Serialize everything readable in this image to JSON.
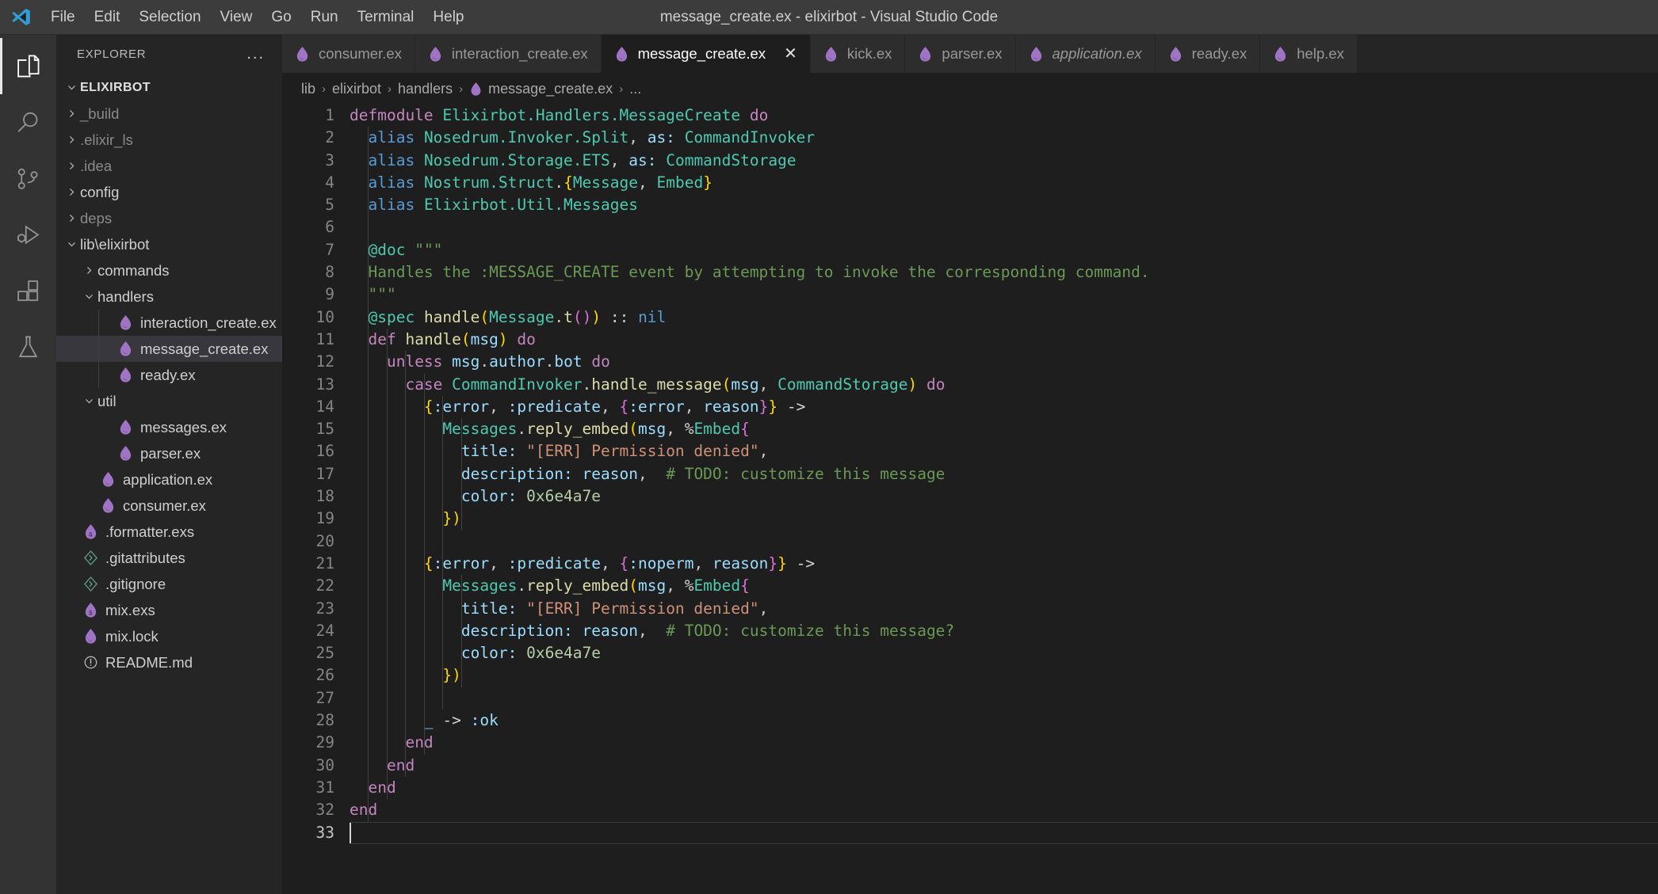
{
  "window": {
    "title": "message_create.ex - elixirbot - Visual Studio Code",
    "logo_icon": "vscode-logo-icon"
  },
  "menubar": {
    "items": [
      {
        "label": "File"
      },
      {
        "label": "Edit"
      },
      {
        "label": "Selection"
      },
      {
        "label": "View"
      },
      {
        "label": "Go"
      },
      {
        "label": "Run"
      },
      {
        "label": "Terminal"
      },
      {
        "label": "Help"
      }
    ]
  },
  "activity_bar": {
    "items": [
      {
        "name": "explorer-icon",
        "label": "Explorer",
        "active": true
      },
      {
        "name": "search-icon",
        "label": "Search",
        "active": false
      },
      {
        "name": "source-control-icon",
        "label": "Source Control",
        "active": false
      },
      {
        "name": "run-and-debug-icon",
        "label": "Run and Debug",
        "active": false
      },
      {
        "name": "extensions-icon",
        "label": "Extensions",
        "active": false
      },
      {
        "name": "testing-flask-icon",
        "label": "Testing",
        "active": false
      }
    ]
  },
  "sidebar": {
    "header_title": "EXPLORER",
    "more_actions": "...",
    "root": {
      "label": "ELIXIRBOT",
      "expanded": true
    },
    "tree": [
      {
        "label": "_build",
        "kind": "folder",
        "depth": 1,
        "expanded": false,
        "dim": true
      },
      {
        "label": ".elixir_ls",
        "kind": "folder",
        "depth": 1,
        "expanded": false,
        "dim": true
      },
      {
        "label": ".idea",
        "kind": "folder",
        "depth": 1,
        "expanded": false,
        "dim": true
      },
      {
        "label": "config",
        "kind": "folder",
        "depth": 1,
        "expanded": false,
        "dim": false
      },
      {
        "label": "deps",
        "kind": "folder",
        "depth": 1,
        "expanded": false,
        "dim": true
      },
      {
        "label": "lib\\elixirbot",
        "kind": "folder",
        "depth": 1,
        "expanded": true,
        "dim": false
      },
      {
        "label": "commands",
        "kind": "folder",
        "depth": 2,
        "expanded": false,
        "dim": false
      },
      {
        "label": "handlers",
        "kind": "folder",
        "depth": 2,
        "expanded": true,
        "dim": false
      },
      {
        "label": "interaction_create.ex",
        "kind": "file-ex",
        "depth": 3,
        "dim": false
      },
      {
        "label": "message_create.ex",
        "kind": "file-ex",
        "depth": 3,
        "dim": false,
        "selected": true
      },
      {
        "label": "ready.ex",
        "kind": "file-ex",
        "depth": 3,
        "dim": false
      },
      {
        "label": "util",
        "kind": "folder",
        "depth": 2,
        "expanded": true,
        "dim": false
      },
      {
        "label": "messages.ex",
        "kind": "file-ex",
        "depth": 3,
        "dim": false
      },
      {
        "label": "parser.ex",
        "kind": "file-ex",
        "depth": 3,
        "dim": false
      },
      {
        "label": "application.ex",
        "kind": "file-ex",
        "depth": 2,
        "dim": false
      },
      {
        "label": "consumer.ex",
        "kind": "file-ex",
        "depth": 2,
        "dim": false
      },
      {
        "label": ".formatter.exs",
        "kind": "file-exs",
        "depth": 1,
        "dim": false
      },
      {
        "label": ".gitattributes",
        "kind": "file-git",
        "depth": 1,
        "dim": false
      },
      {
        "label": ".gitignore",
        "kind": "file-git",
        "depth": 1,
        "dim": false
      },
      {
        "label": "mix.exs",
        "kind": "file-exs",
        "depth": 1,
        "dim": false
      },
      {
        "label": "mix.lock",
        "kind": "file-ex",
        "depth": 1,
        "dim": false
      },
      {
        "label": "README.md",
        "kind": "file-md",
        "depth": 1,
        "dim": false
      }
    ]
  },
  "tabs": [
    {
      "label": "consumer.ex",
      "active": false,
      "preview": false,
      "closable": false
    },
    {
      "label": "interaction_create.ex",
      "active": false,
      "preview": false,
      "closable": false
    },
    {
      "label": "message_create.ex",
      "active": true,
      "preview": false,
      "closable": true,
      "close_label": "✕"
    },
    {
      "label": "kick.ex",
      "active": false,
      "preview": false,
      "closable": false
    },
    {
      "label": "parser.ex",
      "active": false,
      "preview": false,
      "closable": false
    },
    {
      "label": "application.ex",
      "active": false,
      "preview": true,
      "closable": false
    },
    {
      "label": "ready.ex",
      "active": false,
      "preview": false,
      "closable": false
    },
    {
      "label": "help.ex",
      "active": false,
      "preview": false,
      "closable": false
    }
  ],
  "breadcrumbs": {
    "items": [
      {
        "label": "lib",
        "icon": null
      },
      {
        "label": "elixirbot",
        "icon": null
      },
      {
        "label": "handlers",
        "icon": null
      },
      {
        "label": "message_create.ex",
        "icon": "elixir-file-icon"
      },
      {
        "label": "...",
        "icon": null
      }
    ],
    "separator": "›"
  },
  "editor": {
    "language": "elixir",
    "cursor_line": 33,
    "line_count": 33,
    "line_numbers": [
      "1",
      "2",
      "3",
      "4",
      "5",
      "6",
      "7",
      "8",
      "9",
      "10",
      "11",
      "12",
      "13",
      "14",
      "15",
      "16",
      "17",
      "18",
      "19",
      "20",
      "21",
      "22",
      "23",
      "24",
      "25",
      "26",
      "27",
      "28",
      "29",
      "30",
      "31",
      "32",
      "33"
    ],
    "source_lines": [
      "defmodule Elixirbot.Handlers.MessageCreate do",
      "  alias Nosedrum.Invoker.Split, as: CommandInvoker",
      "  alias Nosedrum.Storage.ETS, as: CommandStorage",
      "  alias Nostrum.Struct.{Message, Embed}",
      "  alias Elixirbot.Util.Messages",
      "",
      "  @doc \"\"\"",
      "  Handles the :MESSAGE_CREATE event by attempting to invoke the corresponding command.",
      "  \"\"\"",
      "  @spec handle(Message.t()) :: nil",
      "  def handle(msg) do",
      "    unless msg.author.bot do",
      "      case CommandInvoker.handle_message(msg, CommandStorage) do",
      "        {:error, :predicate, {:error, reason}} ->",
      "          Messages.reply_embed(msg, %Embed{",
      "            title: \"[ERR] Permission denied\",",
      "            description: reason,  # TODO: customize this message",
      "            color: 0x6e4a7e",
      "          })",
      "",
      "        {:error, :predicate, {:noperm, reason}} ->",
      "          Messages.reply_embed(msg, %Embed{",
      "            title: \"[ERR] Permission denied\",",
      "            description: reason,  # TODO: customize this message?",
      "            color: 0x6e4a7e",
      "          })",
      "",
      "        _ -> :ok",
      "      end",
      "    end",
      "  end",
      "end",
      ""
    ]
  },
  "colors": {
    "titlebar_bg": "#3c3c3c",
    "activitybar_bg": "#333333",
    "sidebar_bg": "#252526",
    "editor_bg": "#1e1e1e",
    "tab_inactive_bg": "#2d2d2d",
    "elixir_purple": "#a074c4",
    "keyword": "#C586C0",
    "type": "#4EC9B0",
    "variable": "#9CDCFE",
    "string": "#CE9178",
    "comment": "#6A9955",
    "number": "#B5CEA8",
    "function": "#DCDCAA",
    "bracket1": "#FFD700",
    "bracket2": "#DA70D6",
    "bracket3": "#179FFF"
  }
}
